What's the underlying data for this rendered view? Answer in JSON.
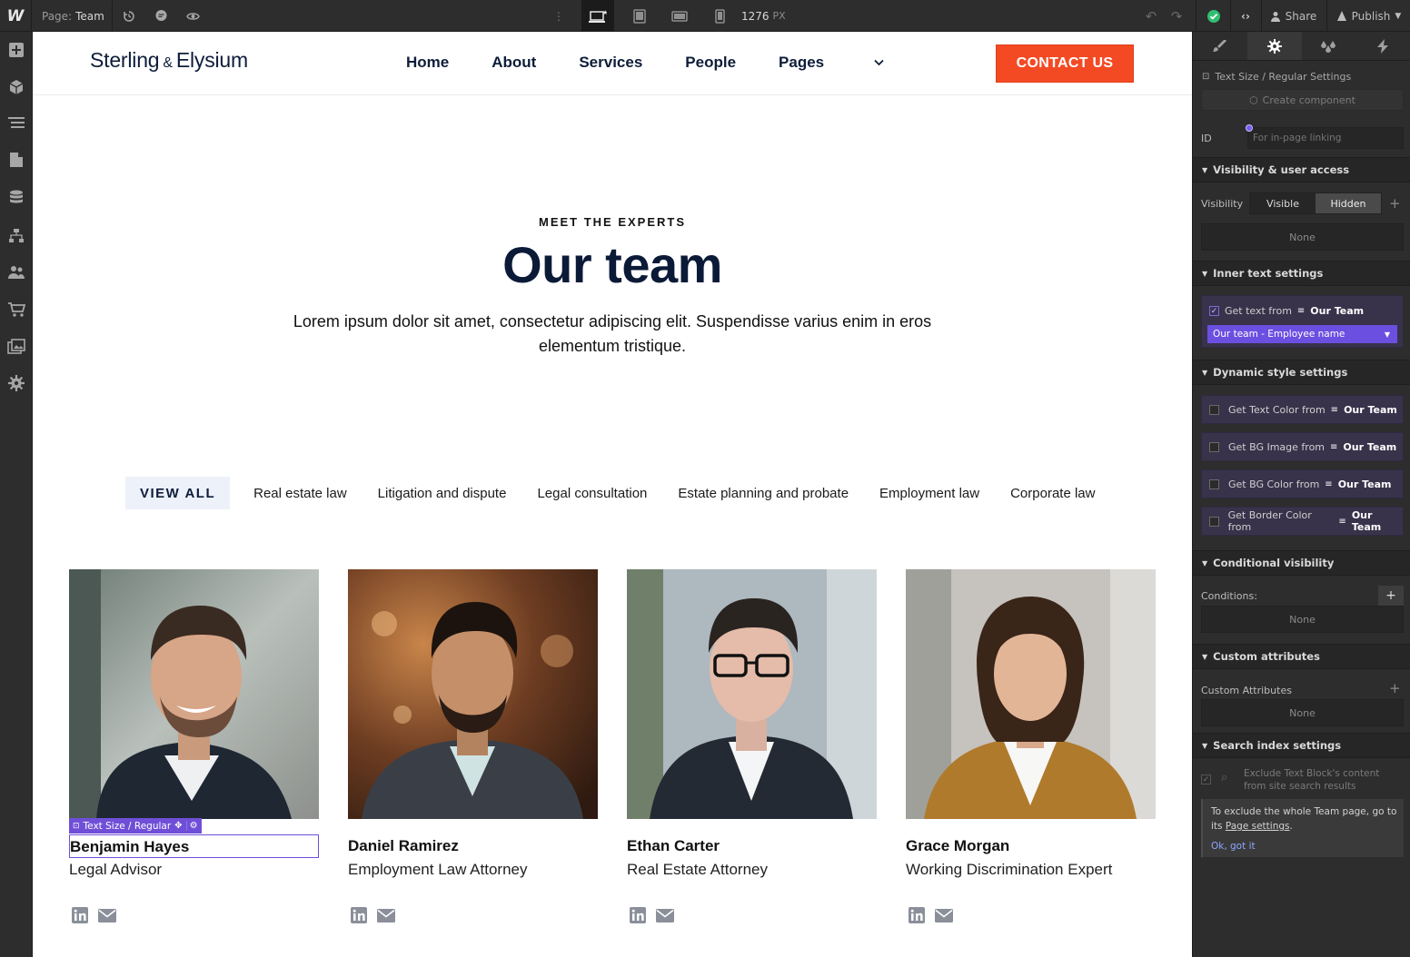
{
  "topbar": {
    "logo": "W",
    "page_label": "Page:",
    "page_value": "Team",
    "width_value": "1276",
    "width_unit": "PX",
    "share_label": "Share",
    "publish_label": "Publish"
  },
  "site": {
    "brand_left": "Sterling",
    "brand_amp": "&",
    "brand_right": "Elysium",
    "nav": [
      "Home",
      "About",
      "Services",
      "People",
      "Pages"
    ],
    "contact_label": "CONTACT US",
    "eyebrow": "MEET THE EXPERTS",
    "title": "Our team",
    "lead": "Lorem ipsum dolor sit amet, consectetur adipiscing elit. Suspendisse varius enim in eros elementum tristique.",
    "filters": [
      "VIEW ALL",
      "Real estate law",
      "Litigation and dispute",
      "Legal consultation",
      "Estate planning and probate",
      "Employment law",
      "Corporate law"
    ],
    "team": [
      {
        "name": "Benjamin Hayes",
        "role": "Legal Advisor"
      },
      {
        "name": "Daniel Ramirez",
        "role": "Employment Law Attorney"
      },
      {
        "name": "Ethan Carter",
        "role": "Real Estate Attorney"
      },
      {
        "name": "Grace Morgan",
        "role": "Working Discrimination Expert"
      }
    ],
    "selection_tag": "Text Size / Regular"
  },
  "panel": {
    "breadcrumb": "Text Size / Regular Settings",
    "create_component": "Create component",
    "id_label": "ID",
    "id_placeholder": "For in-page linking",
    "visibility_section": "Visibility & user access",
    "visibility_label": "Visibility",
    "visible_btn": "Visible",
    "hidden_btn": "Hidden",
    "visibility_none": "None",
    "inner_text_section": "Inner text settings",
    "get_text_from": "Get text from",
    "source": "Our Team",
    "field_select": "Our team - Employee name",
    "dynamic_section": "Dynamic style settings",
    "dynamic_rows": [
      "Get Text Color from",
      "Get BG Image from",
      "Get BG Color from",
      "Get Border Color from"
    ],
    "conditional_section": "Conditional visibility",
    "conditions_label": "Conditions:",
    "conditions_none": "None",
    "custom_attr_section": "Custom attributes",
    "custom_attr_label": "Custom Attributes",
    "custom_attr_none": "None",
    "search_section": "Search index settings",
    "exclude_text": "Exclude Text Block's content from site search results",
    "info_text_a": "To exclude the whole Team page, go to its",
    "info_link": "Page settings",
    "info_ok": "Ok, got it"
  }
}
